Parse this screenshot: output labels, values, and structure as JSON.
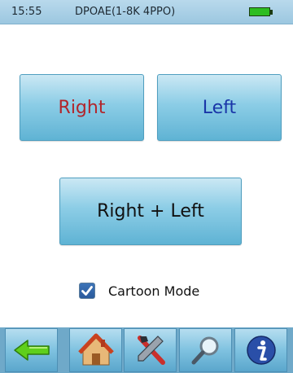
{
  "status_bar": {
    "time": "15:55",
    "title": "DPOAE(1-8K 4PPO)",
    "battery_level": 1.0
  },
  "buttons": {
    "right_label": "Right",
    "left_label": "Left",
    "both_label": "Right + Left"
  },
  "cartoon_mode": {
    "label": "Cartoon Mode",
    "checked": true
  },
  "toolbar": {
    "items": [
      {
        "icon": "back-arrow-icon"
      },
      {
        "icon": "home-icon"
      },
      {
        "icon": "tools-icon"
      },
      {
        "icon": "magnifier-icon"
      },
      {
        "icon": "info-icon"
      }
    ]
  },
  "colors": {
    "right": "#b2252b",
    "left": "#1a36a8",
    "battery": "#2dbd21"
  }
}
